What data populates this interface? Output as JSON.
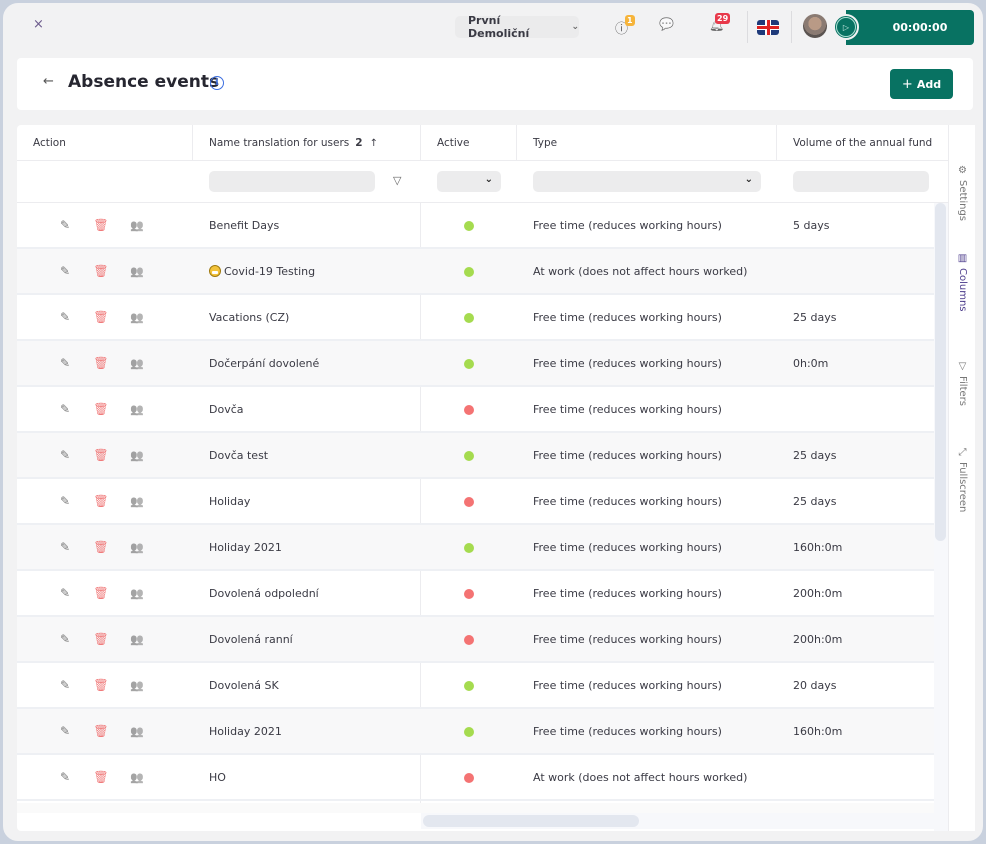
{
  "topbar": {
    "close_icon": "×",
    "company": "První Demoliční",
    "company_chevron": "⌄",
    "alerts_icon": "ⓘ",
    "alerts_count": "1",
    "chat_icon": "💬",
    "notifications_count": "29",
    "language": "English (UK)",
    "timer": "00:00:00",
    "play_icon": "▷"
  },
  "header": {
    "back_icon": "←",
    "title": "Absence events",
    "info_icon": "i",
    "add_plus": "+",
    "add_label": "Add"
  },
  "table": {
    "columns": {
      "action": "Action",
      "name": "Name translation for users",
      "name_sort_index": "2",
      "name_sort_arrow": "↑",
      "active": "Active",
      "type": "Type",
      "volume": "Volume of the annual fund"
    },
    "filters": {
      "name_value": "",
      "active_value": "",
      "type_value": "",
      "volume_value": "",
      "funnel_icon": "▽",
      "chevron": "⌄"
    },
    "action_icons": {
      "edit": "✎",
      "delete": "🗑",
      "users": "👥"
    },
    "rows": [
      {
        "name": "Benefit Days",
        "active": true,
        "type": "Free time (reduces working hours)",
        "volume": "5 days"
      },
      {
        "name": "Covid-19 Testing",
        "emoji": true,
        "active": true,
        "type": "At work (does not affect hours worked)",
        "volume": ""
      },
      {
        "name": "Vacations (CZ)",
        "active": true,
        "type": "Free time (reduces working hours)",
        "volume": "25 days"
      },
      {
        "name": "Dočerpání dovolené",
        "active": true,
        "type": "Free time (reduces working hours)",
        "volume": "0h:0m"
      },
      {
        "name": "Dovča",
        "active": false,
        "type": "Free time (reduces working hours)",
        "volume": ""
      },
      {
        "name": "Dovča test",
        "active": true,
        "type": "Free time (reduces working hours)",
        "volume": "25 days"
      },
      {
        "name": "Holiday",
        "active": false,
        "type": "Free time (reduces working hours)",
        "volume": "25 days"
      },
      {
        "name": "Holiday 2021",
        "active": true,
        "type": "Free time (reduces working hours)",
        "volume": "160h:0m"
      },
      {
        "name": "Dovolená odpolední",
        "active": false,
        "type": "Free time (reduces working hours)",
        "volume": "200h:0m"
      },
      {
        "name": "Dovolená ranní",
        "active": false,
        "type": "Free time (reduces working hours)",
        "volume": "200h:0m"
      },
      {
        "name": "Dovolená SK",
        "active": true,
        "type": "Free time (reduces working hours)",
        "volume": "20 days"
      },
      {
        "name": "Holiday 2021",
        "active": true,
        "type": "Free time (reduces working hours)",
        "volume": "160h:0m"
      },
      {
        "name": "HO",
        "active": false,
        "type": "At work (does not affect hours worked)",
        "volume": ""
      }
    ]
  },
  "side_panel": {
    "items": [
      {
        "label": "Settings",
        "icon": "⚙",
        "active": false
      },
      {
        "label": "Columns",
        "icon": "▥",
        "active": true
      },
      {
        "label": "Filters",
        "icon": "▽",
        "active": false
      },
      {
        "label": "Fullscreen",
        "icon": "⤢",
        "active": false
      }
    ]
  },
  "colors": {
    "brand": "#087262",
    "active_dot": "#a5db4f",
    "inactive_dot": "#f47373",
    "accent_purple": "#4a3a8a",
    "info_blue": "#3d6fe0"
  }
}
